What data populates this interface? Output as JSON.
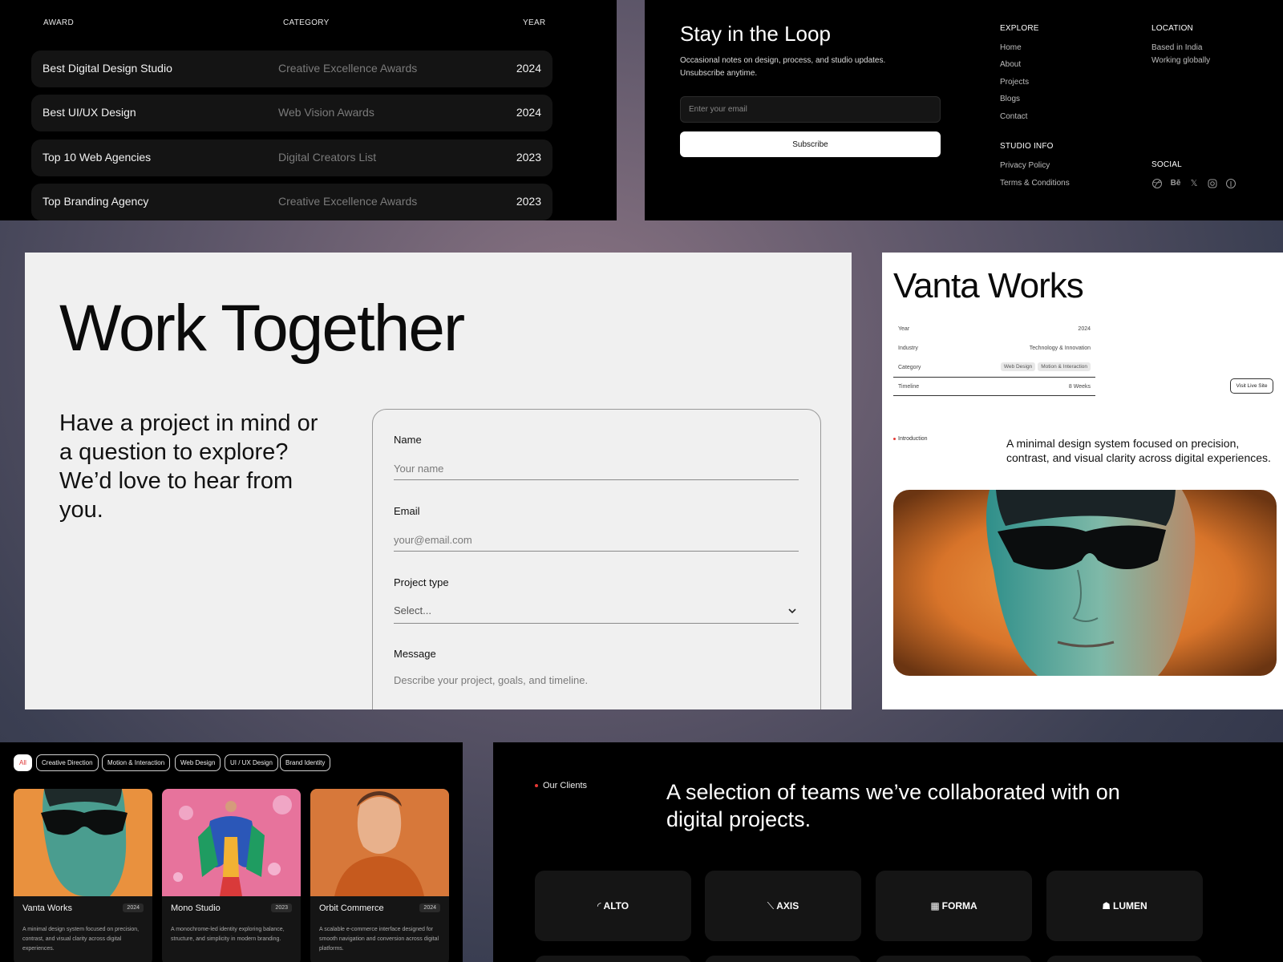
{
  "awards": {
    "headers": {
      "award": "AWARD",
      "category": "CATEGORY",
      "year": "YEAR"
    },
    "rows": [
      {
        "name": "Best Digital Design Studio",
        "category": "Creative Excellence Awards",
        "year": "2024"
      },
      {
        "name": "Best UI/UX Design",
        "category": "Web Vision Awards",
        "year": "2024"
      },
      {
        "name": "Top 10 Web Agencies",
        "category": "Digital Creators List",
        "year": "2023"
      },
      {
        "name": "Top Branding Agency",
        "category": "Creative Excellence Awards",
        "year": "2023"
      }
    ]
  },
  "newsletter": {
    "title": "Stay in the Loop",
    "description": "Occasional notes on design, process, and studio updates. Unsubscribe anytime.",
    "email_placeholder": "Enter your email",
    "subscribe_label": "Subscribe",
    "explore": {
      "heading": "EXPLORE",
      "links": [
        "Home",
        "About",
        "Projects",
        "Blogs",
        "Contact"
      ]
    },
    "location": {
      "heading": "LOCATION",
      "lines": [
        "Based in India",
        "Working globally"
      ]
    },
    "studio_info": {
      "heading": "STUDIO INFO",
      "links": [
        "Privacy Policy",
        "Terms & Conditions"
      ]
    },
    "social": {
      "heading": "SOCIAL",
      "icons": [
        "dribbble-icon",
        "behance-icon",
        "x-icon",
        "instagram-icon",
        "pinterest-icon"
      ]
    }
  },
  "contact": {
    "title": "Work Together",
    "subtitle": "Have a project in mind or a question to explore? We’d love to hear from you.",
    "fields": {
      "name": {
        "label": "Name",
        "placeholder": "Your name"
      },
      "email": {
        "label": "Email",
        "placeholder": "your@email.com"
      },
      "project_type": {
        "label": "Project type",
        "value": "Select..."
      },
      "message": {
        "label": "Message",
        "placeholder": "Describe your project, goals, and timeline."
      }
    }
  },
  "project": {
    "title": "Vanta Works",
    "meta": {
      "year_label": "Year",
      "year_value": "2024",
      "industry_label": "Industry",
      "industry_value": "Technology & Innovation",
      "category_label": "Category",
      "category_chips": [
        "Web Design",
        "Motion & Interaction"
      ],
      "timeline_label": "Timeline",
      "timeline_value": "8 Weeks"
    },
    "visit_label": "Visit Live Site",
    "intro_label": "Introduction",
    "description": "A minimal design system focused on precision, contrast, and visual clarity across digital experiences."
  },
  "works": {
    "filters": [
      "All",
      "Creative Direction",
      "Motion & Interaction",
      "Web Design",
      "UI / UX Design",
      "Brand Identity"
    ],
    "active_filter": "All",
    "cards": [
      {
        "title": "Vanta Works",
        "year": "2024",
        "desc": "A minimal design system focused on precision, contrast, and visual clarity across digital experiences."
      },
      {
        "title": "Mono Studio",
        "year": "2023",
        "desc": "A monochrome-led identity exploring balance, structure, and simplicity in modern branding."
      },
      {
        "title": "Orbit Commerce",
        "year": "2024",
        "desc": "A scalable e-commerce interface designed for smooth navigation and conversion across digital platforms."
      }
    ]
  },
  "clients": {
    "label": "Our Clients",
    "headline": "A selection of teams we’ve collaborated with on digital projects.",
    "logos": [
      "ALTO",
      "AXIS",
      "FORMA",
      "LUMEN"
    ]
  },
  "colors": {
    "accent_red": "#e53935",
    "dark_panel": "#000000",
    "light_panel": "#f0f0f0"
  }
}
